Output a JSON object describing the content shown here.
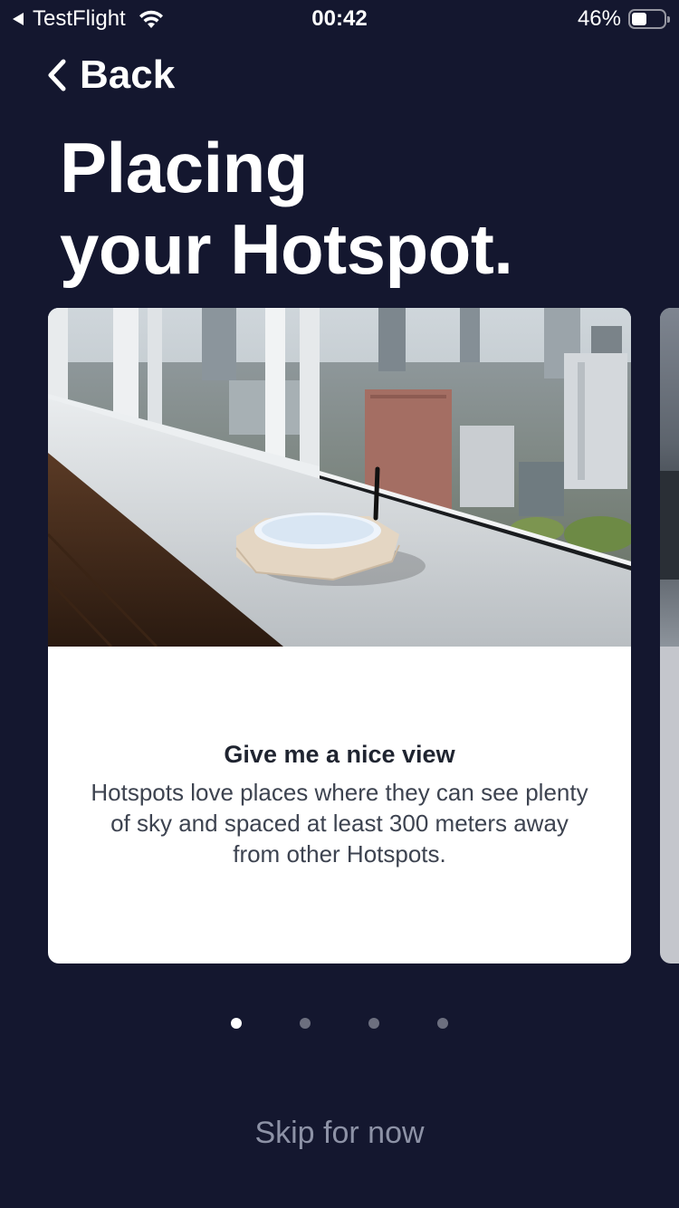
{
  "status_bar": {
    "back_app_label": "TestFlight",
    "time": "00:42",
    "battery_percent_text": "46%",
    "battery_level": 0.46
  },
  "nav": {
    "back_label": "Back"
  },
  "title_lines": [
    "Placing",
    "your Hotspot."
  ],
  "card": {
    "heading": "Give me a nice view",
    "text": "Hotspots love places where they can see plenty of sky and spaced at least 300 meters away from other Hotspots."
  },
  "pager": {
    "count": 4,
    "active_index": 0
  },
  "skip_label": "Skip for now",
  "colors": {
    "background": "#14172f",
    "card": "#ffffff",
    "dot_active": "#ffffff",
    "dot_inactive": "#6c6f7f",
    "skip_text": "#8d92a6"
  }
}
